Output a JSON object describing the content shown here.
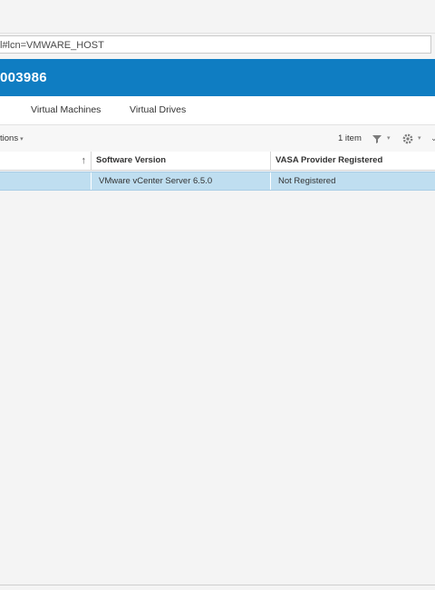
{
  "browser": {
    "address_text": "l#lcn=VMWARE_HOST"
  },
  "header": {
    "title": "003986",
    "background": "#0f7dc2"
  },
  "tabs": [
    {
      "label": "Virtual Machines"
    },
    {
      "label": "Virtual Drives"
    }
  ],
  "toolbar": {
    "actions_label": "tions",
    "item_count": "1 item",
    "filter_icon": "filter-icon",
    "settings_icon": "gear-icon"
  },
  "table": {
    "columns": [
      {
        "label": ""
      },
      {
        "label": "Software Version"
      },
      {
        "label": "VASA Provider Registered"
      }
    ],
    "rows": [
      {
        "cells": [
          "",
          "VMware vCenter Server 6.5.0",
          "Not Registered"
        ]
      }
    ],
    "selected_row_color": "#bfdef0"
  }
}
